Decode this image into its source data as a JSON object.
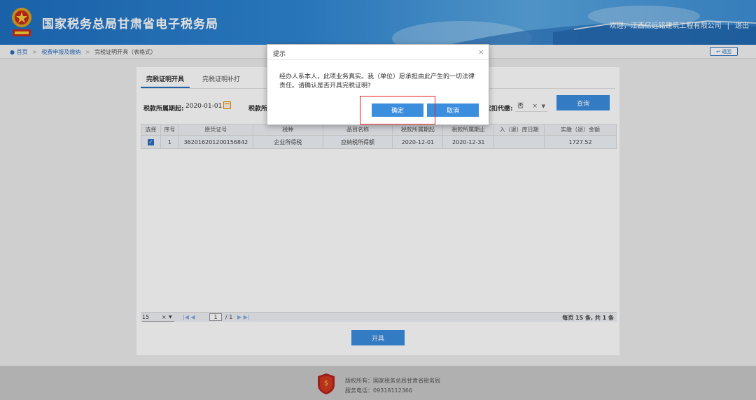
{
  "header": {
    "title": "国家税务总局甘肃省电子税务局",
    "welcome": "欢迎，江西亿远铭建筑工程有限公司",
    "logout": "退出"
  },
  "breadcrumb": {
    "home": "首页",
    "level2": "税费申报及缴纳",
    "current": "完税证明开具（表格式）",
    "back": "返回"
  },
  "tabs": [
    {
      "label": "完税证明开具"
    },
    {
      "label": "完税证明补打"
    }
  ],
  "filters": {
    "period_start_label": "税款所属期起:",
    "period_start_value": "2020-01-01",
    "period_end_label": "税款所",
    "withholding_label": "代扣代缴:",
    "withholding_value": "否",
    "clear": "×",
    "query_label": "查询"
  },
  "table": {
    "columns": [
      "选择",
      "序号",
      "原凭证号",
      "税种",
      "品目名称",
      "税款所属期起",
      "税款所属期止",
      "入（退）库日期",
      "实缴（退）金额"
    ],
    "rows": [
      {
        "checked": "✓",
        "seq": "1",
        "voucher": "362016201200156842",
        "tax_type": "企业所得税",
        "item": "应纳税所得额",
        "start": "2020-12-01",
        "end": "2020-12-31",
        "date": "",
        "amount": "1727.52"
      }
    ]
  },
  "pager": {
    "page_size": "15",
    "clear": "×",
    "first": "|◀",
    "prev": "◀",
    "page": "1",
    "total_pages": "/ 1",
    "next": "▶",
    "last": "▶|",
    "summary": "每页 15 条, 共 1 条"
  },
  "issue_button": "开具",
  "footer": {
    "copyright": "版权所有：国家税务总局甘肃省税务局",
    "phone": "服务电话：09318112366"
  },
  "dialog": {
    "title": "提示",
    "close": "×",
    "message": "经办人系本人，此项业务真实。我（单位）愿承担由此产生的一切法律责任。请确认是否开具完税证明?",
    "ok": "确定",
    "cancel": "取消"
  },
  "colors": {
    "primary": "#3b8ddd",
    "highlight": "#e02020"
  }
}
